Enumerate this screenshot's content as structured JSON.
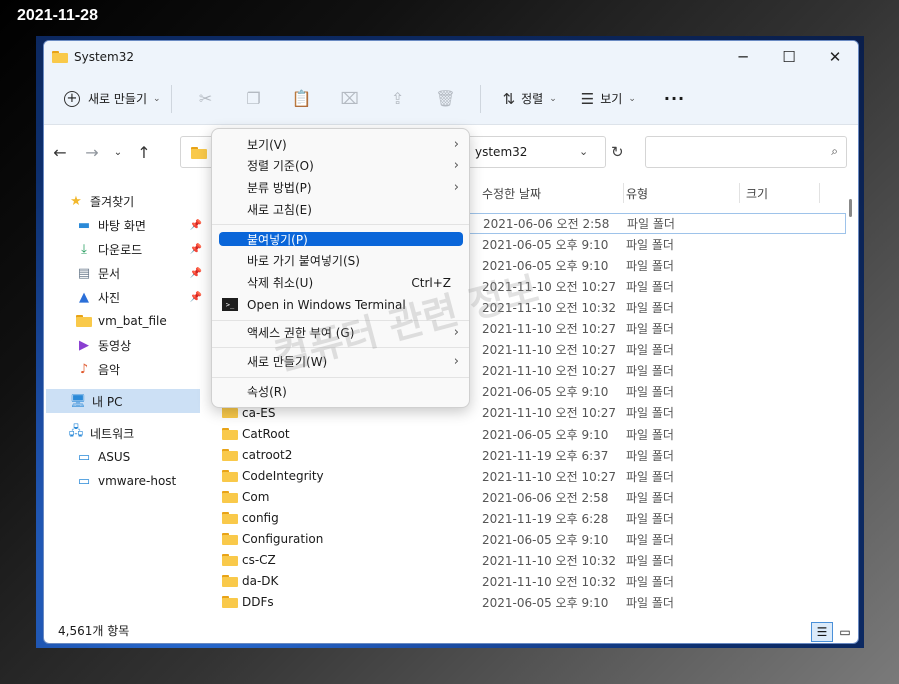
{
  "date_label": "2021-11-28",
  "window": {
    "title": "System32",
    "buttons": {
      "minimize": "─",
      "maximize": "☐",
      "close": "✕"
    }
  },
  "toolbar": {
    "new_label": "새로 만들기",
    "sort_label": "정렬",
    "view_label": "보기",
    "more_label": "···"
  },
  "address": {
    "path_visible": "ystem32"
  },
  "sidebar": {
    "items": [
      {
        "label": "즐겨찾기",
        "icon": "star-icon",
        "pinned": false
      },
      {
        "label": "바탕 화면",
        "icon": "desktop-icon",
        "pinned": true
      },
      {
        "label": "다운로드",
        "icon": "download-icon",
        "pinned": true
      },
      {
        "label": "문서",
        "icon": "document-icon",
        "pinned": true
      },
      {
        "label": "사진",
        "icon": "picture-icon",
        "pinned": true
      },
      {
        "label": "vm_bat_file",
        "icon": "folder-icon",
        "pinned": false
      },
      {
        "label": "동영상",
        "icon": "video-icon",
        "pinned": false
      },
      {
        "label": "음악",
        "icon": "music-icon",
        "pinned": false
      },
      {
        "label": "내 PC",
        "icon": "pc-icon",
        "pinned": false
      },
      {
        "label": "네트워크",
        "icon": "network-icon",
        "pinned": false
      },
      {
        "label": "ASUS",
        "icon": "computer-icon",
        "pinned": false
      },
      {
        "label": "vmware-host",
        "icon": "computer-icon",
        "pinned": false
      }
    ]
  },
  "columns": {
    "date": "수정한 날짜",
    "type": "유형",
    "size": "크기"
  },
  "files": [
    {
      "name": "",
      "date": "2021-06-06 오전 2:58",
      "type": "파일 폴더"
    },
    {
      "name": "",
      "date": "2021-06-05 오후 9:10",
      "type": "파일 폴더"
    },
    {
      "name": "",
      "date": "2021-06-05 오후 9:10",
      "type": "파일 폴더"
    },
    {
      "name": "",
      "date": "2021-11-10 오전 10:27",
      "type": "파일 폴더"
    },
    {
      "name": "",
      "date": "2021-11-10 오전 10:32",
      "type": "파일 폴더"
    },
    {
      "name": "",
      "date": "2021-11-10 오전 10:27",
      "type": "파일 폴더"
    },
    {
      "name": "",
      "date": "2021-11-10 오전 10:27",
      "type": "파일 폴더"
    },
    {
      "name": "",
      "date": "2021-11-10 오전 10:27",
      "type": "파일 폴더"
    },
    {
      "name": "",
      "date": "2021-06-05 오후 9:10",
      "type": "파일 폴더"
    },
    {
      "name": "ca-ES",
      "date": "2021-11-10 오전 10:27",
      "type": "파일 폴더"
    },
    {
      "name": "CatRoot",
      "date": "2021-06-05 오후 9:10",
      "type": "파일 폴더"
    },
    {
      "name": "catroot2",
      "date": "2021-11-19 오후 6:37",
      "type": "파일 폴더"
    },
    {
      "name": "CodeIntegrity",
      "date": "2021-11-10 오전 10:27",
      "type": "파일 폴더"
    },
    {
      "name": "Com",
      "date": "2021-06-06 오전 2:58",
      "type": "파일 폴더"
    },
    {
      "name": "config",
      "date": "2021-11-19 오후 6:28",
      "type": "파일 폴더"
    },
    {
      "name": "Configuration",
      "date": "2021-06-05 오후 9:10",
      "type": "파일 폴더"
    },
    {
      "name": "cs-CZ",
      "date": "2021-11-10 오전 10:32",
      "type": "파일 폴더"
    },
    {
      "name": "da-DK",
      "date": "2021-11-10 오전 10:32",
      "type": "파일 폴더"
    },
    {
      "name": "DDFs",
      "date": "2021-06-05 오후 9:10",
      "type": "파일 폴더"
    }
  ],
  "status": {
    "item_count": "4,561개 항목"
  },
  "context_menu": {
    "items": [
      {
        "label": "보기(V)",
        "submenu": true
      },
      {
        "label": "정렬 기준(O)",
        "submenu": true
      },
      {
        "label": "분류 방법(P)",
        "submenu": true
      },
      {
        "label": "새로 고침(E)",
        "submenu": false
      },
      {
        "label": "붙여넣기(P)",
        "submenu": false,
        "active": true
      },
      {
        "label": "바로 가기 붙여넣기(S)",
        "submenu": false
      },
      {
        "label": "삭제 취소(U)",
        "shortcut": "Ctrl+Z"
      },
      {
        "label": "Open in Windows Terminal",
        "icon": "terminal-icon"
      },
      {
        "label": "액세스 권한 부여 (G)",
        "submenu": true
      },
      {
        "label": "새로 만들기(W)",
        "submenu": true
      },
      {
        "label": "속성(R)",
        "submenu": false
      }
    ]
  },
  "watermark": "컴퓨터 관련 정보",
  "accent_color": "#0a66d9"
}
